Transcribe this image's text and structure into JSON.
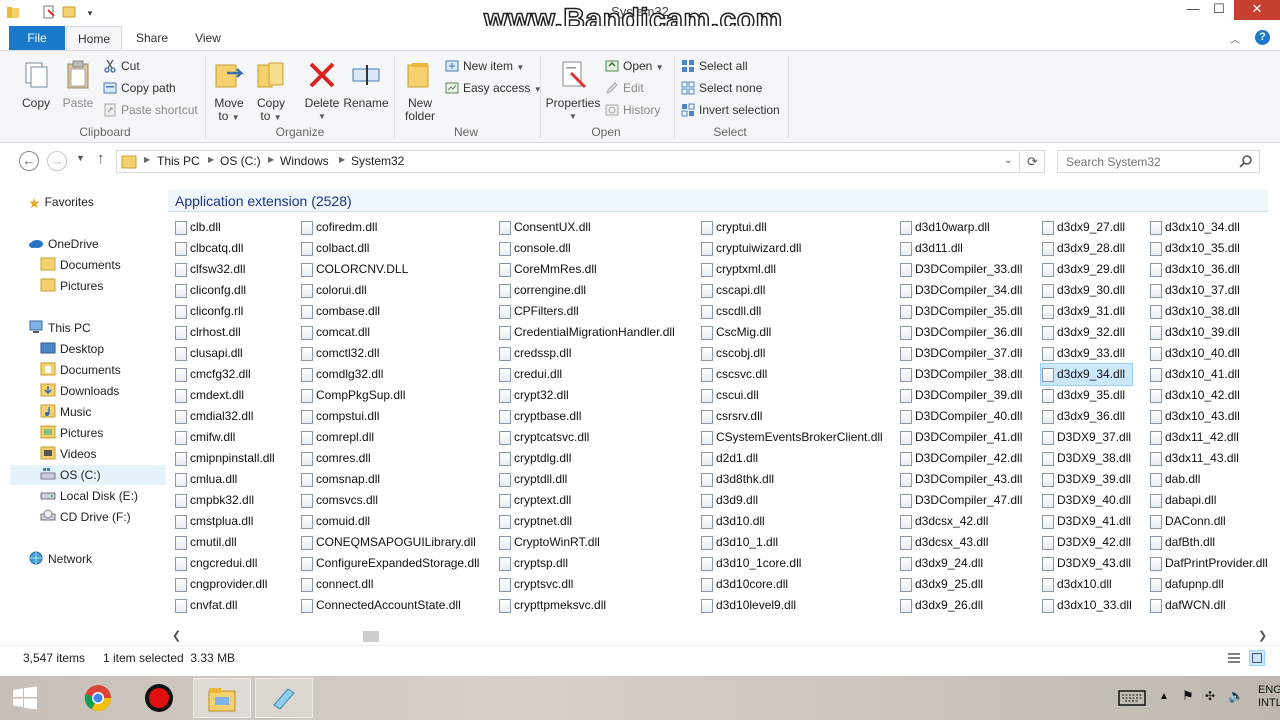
{
  "window": {
    "title": "System32",
    "watermark": "www.Bandicam.com"
  },
  "tabs": [
    {
      "label": "File"
    },
    {
      "label": "Home"
    },
    {
      "label": "Share"
    },
    {
      "label": "View"
    }
  ],
  "ribbon": {
    "clipboard": {
      "group": "Clipboard",
      "copy": "Copy",
      "paste": "Paste",
      "cut": "Cut",
      "copy_path": "Copy path",
      "paste_shortcut": "Paste shortcut"
    },
    "organize": {
      "group": "Organize",
      "move_to_1": "Move",
      "move_to_2": "to",
      "copy_to_1": "Copy",
      "copy_to_2": "to",
      "delete": "Delete",
      "rename": "Rename"
    },
    "new": {
      "group": "New",
      "new_folder_1": "New",
      "new_folder_2": "folder",
      "new_item": "New item",
      "easy_access": "Easy access"
    },
    "open": {
      "group": "Open",
      "properties": "Properties",
      "open": "Open",
      "edit": "Edit",
      "history": "History"
    },
    "select": {
      "group": "Select",
      "select_all": "Select all",
      "select_none": "Select none",
      "invert": "Invert selection"
    }
  },
  "address": {
    "crumbs": [
      "This PC",
      "OS (C:)",
      "Windows",
      "System32"
    ],
    "search_placeholder": "Search System32"
  },
  "nav": {
    "favorites": "Favorites",
    "onedrive": "OneDrive",
    "od_documents": "Documents",
    "od_pictures": "Pictures",
    "thispc": "This PC",
    "desktop": "Desktop",
    "documents": "Documents",
    "downloads": "Downloads",
    "music": "Music",
    "pictures": "Pictures",
    "videos": "Videos",
    "osc": "OS (C:)",
    "locale": "Local Disk (E:)",
    "cdf": "CD Drive (F:)",
    "network": "Network"
  },
  "group_title": "Application extension (2528)",
  "files": [
    [
      "clb.dll",
      "clbcatq.dll",
      "clfsw32.dll",
      "cliconfg.dll",
      "cliconfg.rll",
      "clrhost.dll",
      "clusapi.dll",
      "cmcfg32.dll",
      "cmdext.dll",
      "cmdial32.dll",
      "cmifw.dll",
      "cmipnpinstall.dll",
      "cmlua.dll",
      "cmpbk32.dll",
      "cmstplua.dll",
      "cmutil.dll",
      "cngcredui.dll",
      "cngprovider.dll",
      "cnvfat.dll"
    ],
    [
      "cofiredm.dll",
      "colbact.dll",
      "COLORCNV.DLL",
      "colorui.dll",
      "combase.dll",
      "comcat.dll",
      "comctl32.dll",
      "comdlg32.dll",
      "CompPkgSup.dll",
      "compstui.dll",
      "comrepl.dll",
      "comres.dll",
      "comsnap.dll",
      "comsvcs.dll",
      "comuid.dll",
      "CONEQMSAPOGUILibrary.dll",
      "ConfigureExpandedStorage.dll",
      "connect.dll",
      "ConnectedAccountState.dll"
    ],
    [
      "ConsentUX.dll",
      "console.dll",
      "CoreMmRes.dll",
      "correngine.dll",
      "CPFilters.dll",
      "CredentialMigrationHandler.dll",
      "credssp.dll",
      "credui.dll",
      "crypt32.dll",
      "cryptbase.dll",
      "cryptcatsvc.dll",
      "cryptdlg.dll",
      "cryptdll.dll",
      "cryptext.dll",
      "cryptnet.dll",
      "CryptoWinRT.dll",
      "cryptsp.dll",
      "cryptsvc.dll",
      "crypttpmeksvc.dll"
    ],
    [
      "cryptui.dll",
      "cryptuiwizard.dll",
      "cryptxml.dll",
      "cscapi.dll",
      "cscdll.dll",
      "CscMig.dll",
      "cscobj.dll",
      "cscsvc.dll",
      "cscui.dll",
      "csrsrv.dll",
      "CSystemEventsBrokerClient.dll",
      "d2d1.dll",
      "d3d8thk.dll",
      "d3d9.dll",
      "d3d10.dll",
      "d3d10_1.dll",
      "d3d10_1core.dll",
      "d3d10core.dll",
      "d3d10level9.dll"
    ],
    [
      "d3d10warp.dll",
      "d3d11.dll",
      "D3DCompiler_33.dll",
      "D3DCompiler_34.dll",
      "D3DCompiler_35.dll",
      "D3DCompiler_36.dll",
      "D3DCompiler_37.dll",
      "D3DCompiler_38.dll",
      "D3DCompiler_39.dll",
      "D3DCompiler_40.dll",
      "D3DCompiler_41.dll",
      "D3DCompiler_42.dll",
      "D3DCompiler_43.dll",
      "D3DCompiler_47.dll",
      "d3dcsx_42.dll",
      "d3dcsx_43.dll",
      "d3dx9_24.dll",
      "d3dx9_25.dll",
      "d3dx9_26.dll"
    ],
    [
      "d3dx9_27.dll",
      "d3dx9_28.dll",
      "d3dx9_29.dll",
      "d3dx9_30.dll",
      "d3dx9_31.dll",
      "d3dx9_32.dll",
      "d3dx9_33.dll",
      "d3dx9_34.dll",
      "d3dx9_35.dll",
      "d3dx9_36.dll",
      "D3DX9_37.dll",
      "D3DX9_38.dll",
      "D3DX9_39.dll",
      "D3DX9_40.dll",
      "D3DX9_41.dll",
      "D3DX9_42.dll",
      "D3DX9_43.dll",
      "d3dx10.dll",
      "d3dx10_33.dll"
    ],
    [
      "d3dx10_34.dll",
      "d3dx10_35.dll",
      "d3dx10_36.dll",
      "d3dx10_37.dll",
      "d3dx10_38.dll",
      "d3dx10_39.dll",
      "d3dx10_40.dll",
      "d3dx10_41.dll",
      "d3dx10_42.dll",
      "d3dx10_43.dll",
      "d3dx11_42.dll",
      "d3dx11_43.dll",
      "dab.dll",
      "dabapi.dll",
      "DAConn.dll",
      "dafBth.dll",
      "DafPrintProvider.dll",
      "dafupnp.dll",
      "dafWCN.dll"
    ]
  ],
  "selected_file": "d3dx9_34.dll",
  "status": {
    "items": "3,547 items",
    "selection": "1 item selected  3.33 MB"
  },
  "taskbar": {
    "lang_1": "ENG",
    "lang_2": "INTL"
  },
  "colors": {
    "accent": "#1979ca",
    "selection": "#cce8ff",
    "group_title": "#1e3287"
  }
}
